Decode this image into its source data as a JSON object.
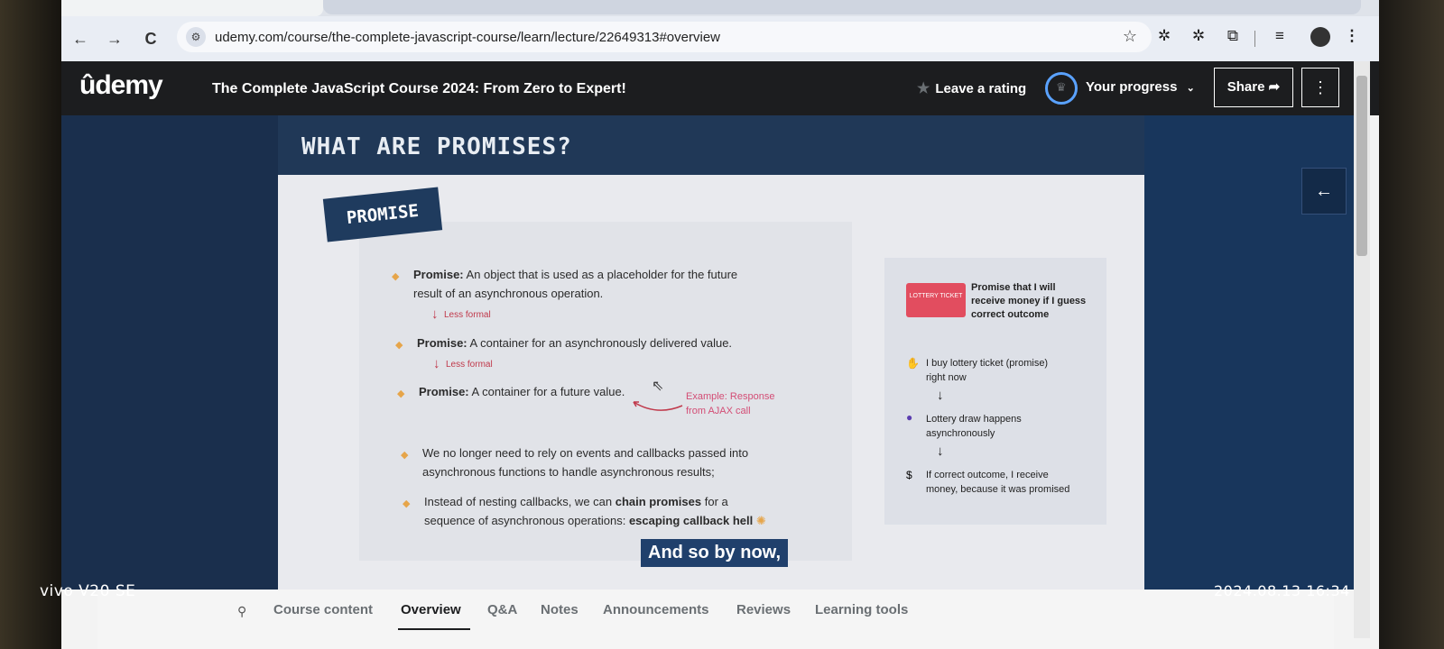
{
  "browser": {
    "url": "udemy.com/course/the-complete-javascript-course/learn/lecture/22649313#overview",
    "nav_back": "←",
    "nav_forward": "→",
    "nav_reload": "C"
  },
  "header": {
    "logo": "ûdemy",
    "course_title": "The Complete JavaScript Course 2024: From Zero to Expert!",
    "leave_rating": "Leave a rating",
    "your_progress": "Your progress",
    "share": "Share",
    "more": "⋮"
  },
  "slide": {
    "title": "WHAT ARE PROMISES?",
    "tag": "PROMISE",
    "def1_bold": "Promise:",
    "def1_line1": " An object that is used as a placeholder for the future",
    "def1_line2": "result of an asynchronous operation.",
    "less_formal_1": "Less formal",
    "def2_bold": "Promise:",
    "def2_text": " A container for an asynchronously delivered value.",
    "less_formal_2": "Less formal",
    "def3_bold": "Promise:",
    "def3_text": " A container for a future value.",
    "example_line1": "Example: Response",
    "example_line2": "from AJAX call",
    "point1_line1": "We no longer need to rely on events and callbacks passed into",
    "point1_line2": "asynchronous functions to handle asynchronous results;",
    "point2_pre": "Instead of nesting callbacks, we can ",
    "point2_bold": "chain promises",
    "point2_post": " for a",
    "point2_line2_pre": "sequence of asynchronous operations: ",
    "point2_line2_bold": "escaping callback hell",
    "right": {
      "ticket_text": "LOTTERY TICKET",
      "promise_line1": "Promise that I will",
      "promise_line2": "receive money if I guess",
      "promise_line3": "correct outcome",
      "step1_line1": "I buy lottery ticket (promise)",
      "step1_line2": "right now",
      "step2_line1": "Lottery draw happens",
      "step2_line2": "asynchronously",
      "step3_line1": "If correct outcome, I receive",
      "step3_line2": "money, because it was promised"
    },
    "caption": "And so by now,"
  },
  "tabs": [
    {
      "label": "Course content"
    },
    {
      "label": "Overview"
    },
    {
      "label": "Q&A"
    },
    {
      "label": "Notes"
    },
    {
      "label": "Announcements"
    },
    {
      "label": "Reviews"
    },
    {
      "label": "Learning tools"
    }
  ],
  "active_tab": "Overview",
  "watermark": {
    "device": "vivo V20 SE",
    "timestamp": "2024.08.13 16:34"
  },
  "colors": {
    "udemy_header": "#1c1d1f",
    "slide_navy": "#203857",
    "progress_ring": "#5aa2ff",
    "note_red": "#c0394b"
  }
}
